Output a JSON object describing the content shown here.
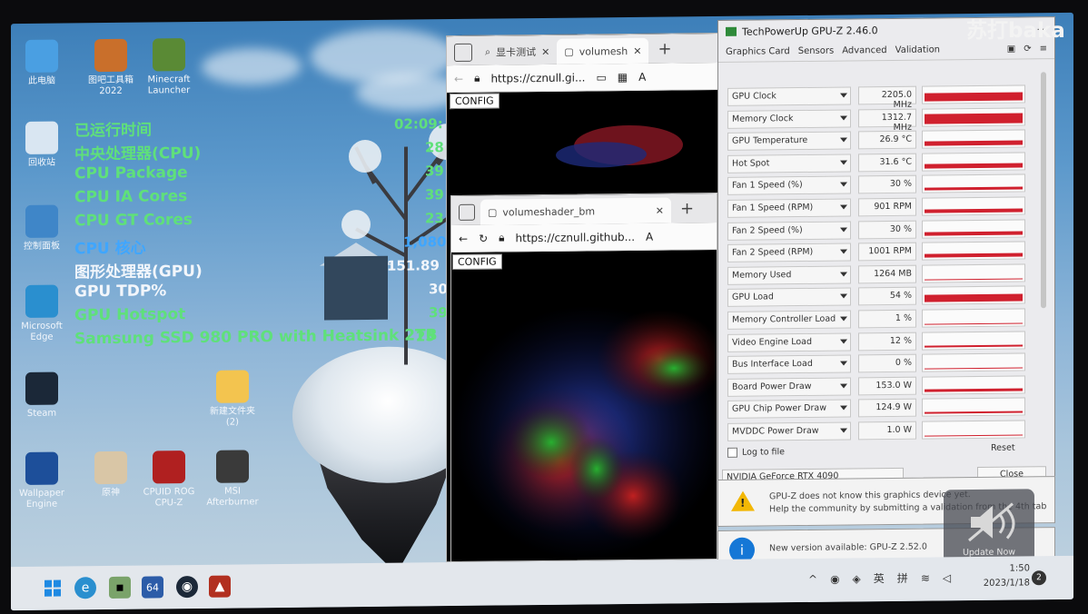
{
  "watermark": "苏打baka",
  "desktop_icons": [
    {
      "label": "此电脑",
      "icon": "computer-icon",
      "color": "#4a9fe2"
    },
    {
      "label": "图吧工具箱\n2022",
      "icon": "toolbox-icon",
      "color": "#c96f2b"
    },
    {
      "label": "Minecraft\nLauncher",
      "icon": "minecraft-icon",
      "color": "#5a8a35"
    },
    {
      "label": "回收站",
      "icon": "recycle-bin-icon",
      "color": "#d9e6f2"
    },
    {
      "label": "控制面板",
      "icon": "control-panel-icon",
      "color": "#3f86c8"
    },
    {
      "label": "Microsoft\nEdge",
      "icon": "edge-icon",
      "color": "#2a8fcf"
    },
    {
      "label": "Steam",
      "icon": "steam-icon",
      "color": "#1b2838"
    },
    {
      "label": "新建文件夹\n(2)",
      "icon": "folder-icon",
      "color": "#f3c44f"
    },
    {
      "label": "Wallpaper\nEngine",
      "icon": "wallpaper-engine-icon",
      "color": "#1d4f9a"
    },
    {
      "label": "原神",
      "icon": "genshin-icon",
      "color": "#d9c6a6"
    },
    {
      "label": "CPUID ROG\nCPU-Z",
      "icon": "cpuz-icon",
      "color": "#b02020"
    },
    {
      "label": "MSI\nAfterburner",
      "icon": "afterburner-icon",
      "color": "#3a3a3a"
    }
  ],
  "overlay": {
    "rows": [
      {
        "label": "已运行时间",
        "color": "#5fe07a"
      },
      {
        "label": "中央处理器(CPU)",
        "color": "#5fe07a"
      },
      {
        "label": "CPU Package",
        "color": "#5fe07a"
      },
      {
        "label": "CPU IA Cores",
        "color": "#5fe07a"
      },
      {
        "label": "CPU GT Cores",
        "color": "#5fe07a"
      },
      {
        "label": "CPU 核心",
        "color": "#3fa6ff"
      },
      {
        "label": "图形处理器(GPU)",
        "color": "#f2f6fb"
      },
      {
        "label": "GPU TDP%",
        "color": "#f2f6fb"
      },
      {
        "label": "GPU Hotspot",
        "color": "#5fe07a"
      },
      {
        "label": "Samsung SSD 980 PRO with Heatsink 2TB",
        "color": "#5fe07a"
      }
    ],
    "values": [
      {
        "text": "02:09:",
        "color": "#5fe07a"
      },
      {
        "text": "28",
        "color": "#5fe07a"
      },
      {
        "text": "39",
        "color": "#5fe07a"
      },
      {
        "text": "39",
        "color": "#5fe07a"
      },
      {
        "text": "23",
        "color": "#5fe07a"
      },
      {
        "text": "1,080",
        "color": "#3fa6ff"
      },
      {
        "text": "151.89",
        "color": "#f2f6fb"
      },
      {
        "text": "30",
        "color": "#f2f6fb"
      },
      {
        "text": "39",
        "color": "#5fe07a"
      },
      {
        "text": "25",
        "color": "#5fe07a"
      }
    ]
  },
  "browser_back": {
    "tabs": [
      "显卡测试",
      "volumesh"
    ],
    "url": "https://cznull.gi...",
    "config": "CONFIG"
  },
  "browser_front": {
    "tab": "volumeshader_bm",
    "url": "https://cznull.github...",
    "config": "CONFIG"
  },
  "gpuz": {
    "title": "TechPowerUp GPU-Z 2.46.0",
    "tabs": [
      "Graphics Card",
      "Sensors",
      "Advanced",
      "Validation"
    ],
    "sensors": [
      {
        "name": "GPU Clock",
        "value": "2205.0 MHz",
        "level": 0.55
      },
      {
        "name": "Memory Clock",
        "value": "1312.7 MHz",
        "level": 0.65
      },
      {
        "name": "GPU Temperature",
        "value": "26.9 °C",
        "level": 0.3
      },
      {
        "name": "Hot Spot",
        "value": "31.6 °C",
        "level": 0.28
      },
      {
        "name": "Fan 1 Speed (%)",
        "value": "30 %",
        "level": 0.22
      },
      {
        "name": "Fan 1 Speed (RPM)",
        "value": "901 RPM",
        "level": 0.25
      },
      {
        "name": "Fan 2 Speed (%)",
        "value": "30 %",
        "level": 0.22
      },
      {
        "name": "Fan 2 Speed (RPM)",
        "value": "1001 RPM",
        "level": 0.25
      },
      {
        "name": "Memory Used",
        "value": "1264 MB",
        "level": 0.0
      },
      {
        "name": "GPU Load",
        "value": "54 %",
        "level": 0.5
      },
      {
        "name": "Memory Controller Load",
        "value": "1 %",
        "level": 0.0
      },
      {
        "name": "Video Engine Load",
        "value": "12 %",
        "level": 0.1
      },
      {
        "name": "Bus Interface Load",
        "value": "0 %",
        "level": 0.0
      },
      {
        "name": "Board Power Draw",
        "value": "153.0 W",
        "level": 0.18
      },
      {
        "name": "GPU Chip Power Draw",
        "value": "124.9 W",
        "level": 0.18
      },
      {
        "name": "MVDDC Power Draw",
        "value": "1.0 W",
        "level": 0.0
      }
    ],
    "log_label": "Log to file",
    "reset_label": "Reset",
    "device": "NVIDIA GeForce RTX 4090",
    "close_label": "Close"
  },
  "notifications": {
    "warning": "GPU-Z does not know this graphics device yet.\nHelp the community by submitting a validation from the 4th tab",
    "update": "New version available: GPU-Z 2.52.0",
    "update_button": "Update Now"
  },
  "taskbar": {
    "ime_lang": "英",
    "ime_mode": "拼",
    "time": "1:50",
    "date": "2023/1/18",
    "badge": "2",
    "tiny_label": "64"
  },
  "colors": {
    "bar_red": "#d0202e",
    "overlay_green": "#5fe07a",
    "overlay_blue": "#3fa6ff"
  }
}
